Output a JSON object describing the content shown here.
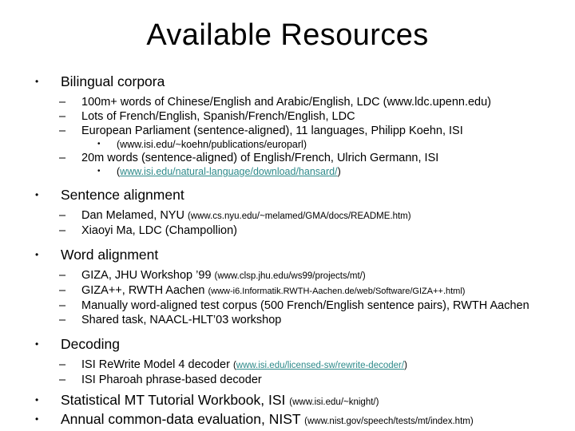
{
  "slide": {
    "title": "Available Resources",
    "bullet_glyph_l1": "•",
    "bullet_glyph_l2": "–",
    "bullet_glyph_l3": "•",
    "link_color": "#2d8a8a",
    "text_color": "#000000",
    "background_color": "#ffffff"
  },
  "sections": {
    "bilingual_corpora": {
      "heading": "Bilingual corpora",
      "items": {
        "chinese_english": {
          "text": "100m+ words of Chinese/English and Arabic/English, LDC (www.ldc.upenn.edu)"
        },
        "french_english": {
          "text": "Lots of French/English, Spanish/French/English, LDC"
        },
        "europarl": {
          "text": "European Parliament (sentence-aligned), 11 languages, Philipp Koehn, ISI",
          "sub_url": "(www.isi.edu/~koehn/publications/europarl)"
        },
        "hansard": {
          "text": "20m words (sentence-aligned) of English/French, Ulrich Germann, ISI",
          "sub_open_paren": "(",
          "sub_link": "www.isi.edu/natural-language/download/hansard/",
          "sub_close_paren": ")"
        }
      }
    },
    "sentence_alignment": {
      "heading": "Sentence alignment",
      "items": {
        "melamed": {
          "lead": "Dan Melamed, NYU ",
          "url": "(www.cs.nyu.edu/~melamed/GMA/docs/README.htm)"
        },
        "champollion": {
          "lead": "Xiaoyi Ma, LDC (Champollion)"
        }
      }
    },
    "word_alignment": {
      "heading": "Word alignment",
      "items": {
        "giza": {
          "lead": "GIZA, JHU Workshop ’99 ",
          "url": "(www.clsp.jhu.edu/ws99/projects/mt/)"
        },
        "gizapp": {
          "lead": "GIZA++, RWTH Aachen ",
          "url": "(www-i6.Informatik.RWTH-Aachen.de/web/Software/GIZA++.html)"
        },
        "manual_corpus": {
          "lead": "Manually word-aligned test corpus (500 French/English sentence pairs), RWTH Aachen"
        },
        "shared_task": {
          "lead": "Shared task, NAACL-HLT’03 workshop"
        }
      }
    },
    "decoding": {
      "heading": "Decoding",
      "items": {
        "rewrite": {
          "lead": "ISI ReWrite Model 4 decoder ",
          "open_paren": "(",
          "link": "www.isi.edu/licensed-sw/rewrite-decoder/",
          "close_paren": ")"
        },
        "pharoah": {
          "lead": "ISI Pharoah phrase-based decoder"
        }
      }
    },
    "workbook": {
      "heading": "Statistical MT Tutorial Workbook, ISI ",
      "url": "(www.isi.edu/~knight/)"
    },
    "evaluation": {
      "heading": "Annual common-data evaluation, NIST ",
      "url": "(www.nist.gov/speech/tests/mt/index.htm)"
    }
  }
}
